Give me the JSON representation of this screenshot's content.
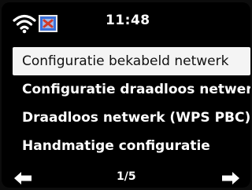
{
  "status": {
    "time": "11:48",
    "wifi_icon": "wifi-signal-icon",
    "network_icon": "network-status-icon"
  },
  "menu": {
    "items": [
      {
        "label": "Configuratie bekabeld netwerk",
        "selected": true
      },
      {
        "label": "Configuratie draadloos netwerk",
        "selected": false
      },
      {
        "label": "Draadloos netwerk (WPS PBC)",
        "selected": false
      },
      {
        "label": "Handmatige configuratie",
        "selected": false
      }
    ]
  },
  "footer": {
    "page": "1/5",
    "prev_icon": "arrow-left-icon",
    "next_icon": "arrow-right-icon"
  },
  "colors": {
    "background": "#000000",
    "text": "#ffffff",
    "selected_bg": "#f4f4f4",
    "selected_text": "#111111",
    "icon_blue": "#3a6fd8",
    "icon_red": "#d03a2a"
  }
}
